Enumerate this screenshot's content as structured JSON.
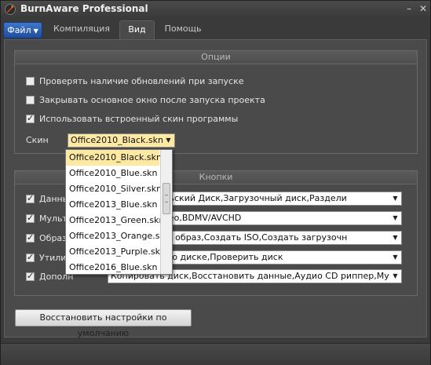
{
  "window": {
    "title": "BurnAware Professional",
    "minimize": "–",
    "close": "✕"
  },
  "tabs": [
    {
      "label": "Файл",
      "active": false
    },
    {
      "label": "Компиляция",
      "active": false
    },
    {
      "label": "Вид",
      "active": true
    },
    {
      "label": "Помощь",
      "active": false
    }
  ],
  "options": {
    "header": "Опции",
    "items": [
      {
        "label": "Проверять наличие обновлений при запуске",
        "checked": false
      },
      {
        "label": "Закрывать основное окно после запуска проекта",
        "checked": false
      },
      {
        "label": "Использовать встроенный скин программы",
        "checked": true
      }
    ],
    "skin_label": "Скин",
    "skin_value": "Office2010_Black.skn"
  },
  "skin_dropdown": {
    "options": [
      "Office2010_Black.skn",
      "Office2010_Blue.skn",
      "Office2010_Silver.skn",
      "Office2013_Blue.skn",
      "Office2013_Green.skn",
      "Office2013_Orange.skn",
      "Office2013_Purple.skn",
      "Office2016_Blue.skn"
    ],
    "selected_index": 0
  },
  "buttons_group": {
    "header": "Кнопки",
    "rows": [
      {
        "label": "Данны",
        "checked": true,
        "value": "Пользовательский Диск,Загрузочный диск,Раздели"
      },
      {
        "label": "Мульт",
        "checked": true,
        "value": "иск,DVD-Видео,BDMV/AVCHD"
      },
      {
        "label": "Образ",
        "checked": true,
        "value": "Копировать в образ,Создать ISO,Создать загрузочн"
      },
      {
        "label": "Утилит",
        "checked": true,
        "value": "Информация о диске,Проверить диск"
      },
      {
        "label": "Дополн",
        "checked": true,
        "value": "Копировать диск,Восстановить данные,Аудио CD риппер,Мультизап"
      }
    ]
  },
  "reset_button": "Восстановить настройки по умолчанию",
  "colors": {
    "accent": "#2a5fb8",
    "selection": "#fde9a2",
    "panel": "#4a4a4a"
  }
}
